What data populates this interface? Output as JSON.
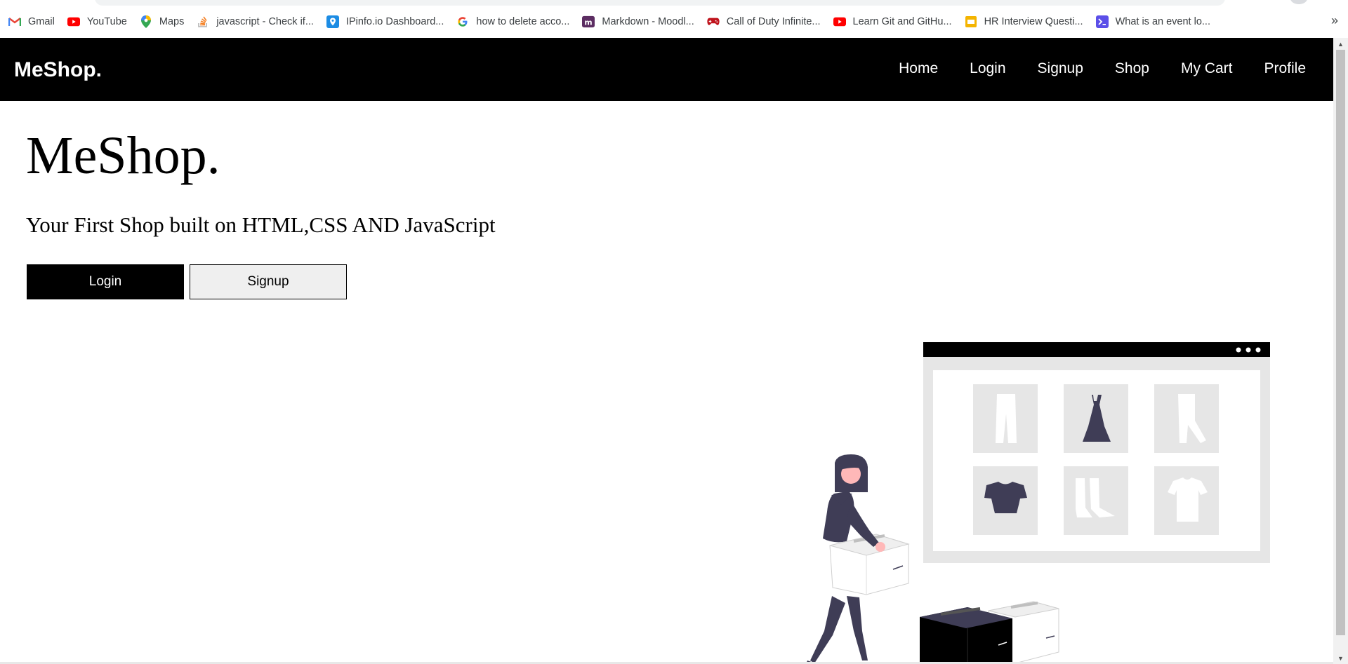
{
  "bookmarks": [
    {
      "label": "Gmail",
      "icon": "gmail-icon"
    },
    {
      "label": "YouTube",
      "icon": "youtube-icon"
    },
    {
      "label": "Maps",
      "icon": "maps-icon"
    },
    {
      "label": "javascript - Check if...",
      "icon": "stackoverflow-icon"
    },
    {
      "label": "IPinfo.io Dashboard...",
      "icon": "ipinfo-icon"
    },
    {
      "label": "how to delete acco...",
      "icon": "google-icon"
    },
    {
      "label": "Markdown - Moodl...",
      "icon": "moodle-icon"
    },
    {
      "label": "Call of Duty Infinite...",
      "icon": "gamepad-icon"
    },
    {
      "label": "Learn Git and GitHu...",
      "icon": "youtube-icon"
    },
    {
      "label": "HR Interview Questi...",
      "icon": "slides-icon"
    },
    {
      "label": "What is an event lo...",
      "icon": "terminal-icon"
    }
  ],
  "bookmarks_more": "»",
  "navbar": {
    "brand": "MeShop.",
    "links": [
      "Home",
      "Login",
      "Signup",
      "Shop",
      "My Cart",
      "Profile"
    ]
  },
  "hero": {
    "title": "MeShop.",
    "subtitle": "Your First Shop built on HTML,CSS AND JavaScript",
    "login_label": "Login",
    "signup_label": "Signup"
  },
  "colors": {
    "navbar_bg": "#000000",
    "accent_dark": "#3f3d56",
    "skin": "#ffb8b8",
    "panel_gray": "#e6e6e6"
  }
}
